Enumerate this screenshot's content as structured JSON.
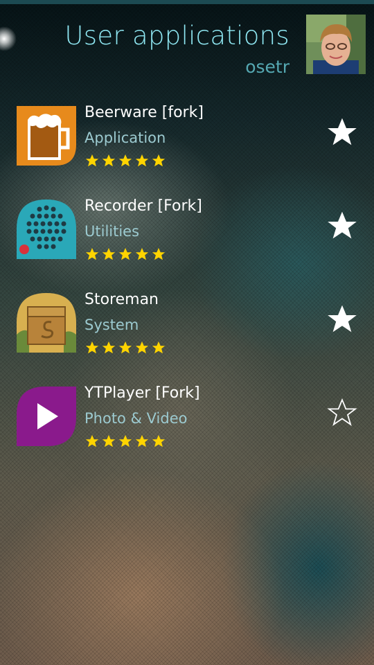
{
  "header": {
    "title": "User applications",
    "username": "osetr"
  },
  "apps": [
    {
      "name": "Beerware [fork]",
      "category": "Application",
      "rating": 5,
      "favorite": true,
      "icon": "beer-mug-icon"
    },
    {
      "name": "Recorder [Fork]",
      "category": "Utilities",
      "rating": 5,
      "favorite": true,
      "icon": "recorder-speaker-icon"
    },
    {
      "name": "Storeman",
      "category": "System",
      "rating": 5,
      "favorite": true,
      "icon": "storeman-box-icon"
    },
    {
      "name": "YTPlayer [Fork]",
      "category": "Photo & Video",
      "rating": 5,
      "favorite": false,
      "icon": "play-icon"
    }
  ],
  "colors": {
    "title": "#8fe7f2",
    "username": "#55a8b2",
    "category": "#9ccad0",
    "rating_star": "#ffd400"
  }
}
